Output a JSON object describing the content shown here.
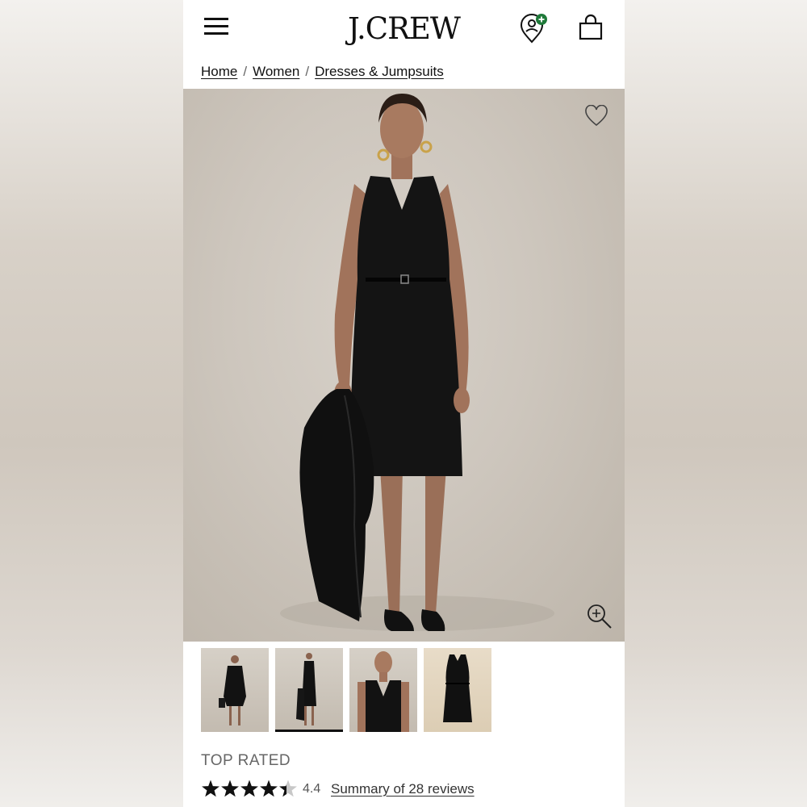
{
  "header": {
    "logo": "J.CREW",
    "menu_icon": "hamburger-menu-icon",
    "store_icon": "store-locator-icon",
    "bag_icon": "shopping-bag-icon"
  },
  "breadcrumb": {
    "items": [
      "Home",
      "Women",
      "Dresses & Jumpsuits"
    ],
    "separator": "/"
  },
  "hero": {
    "wishlist_icon": "heart-icon",
    "zoom_icon": "zoom-in-icon"
  },
  "thumbnails": {
    "count": 4,
    "active_index": 1
  },
  "product": {
    "badge": "TOP RATED",
    "rating": "4.4",
    "rating_value": 4.4,
    "rating_max": 5,
    "reviews_link": "Summary of 28 reviews"
  },
  "colors": {
    "brand_green": "#1f7a3a",
    "text": "#111111",
    "muted": "#666666"
  }
}
